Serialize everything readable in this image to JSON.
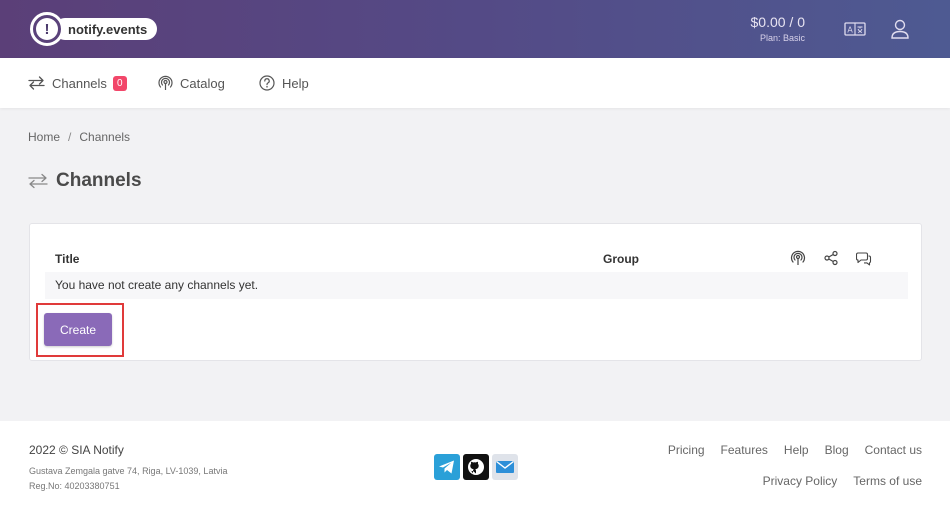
{
  "header": {
    "logo_text": "notify.events",
    "logo_mark": "!",
    "balance": "$0.00 / 0",
    "plan": "Plan: Basic",
    "icons": [
      "language-icon",
      "user-icon"
    ]
  },
  "nav": {
    "channels": {
      "label": "Channels",
      "badge": "0",
      "icon": "arrows-exchange-icon"
    },
    "catalog": {
      "label": "Catalog",
      "icon": "broadcast-icon"
    },
    "help": {
      "label": "Help",
      "icon": "question-circle-icon"
    }
  },
  "breadcrumb": [
    "Home",
    "Channels"
  ],
  "page": {
    "title": "Channels",
    "icon": "arrows-exchange-icon"
  },
  "table": {
    "columns": {
      "title": "Title",
      "group": "Group"
    },
    "column_icons": [
      "broadcast-icon",
      "share-icon",
      "chat-icon"
    ],
    "empty_text": "You have not create any channels yet."
  },
  "create_button": "Create",
  "accent_color": "#8a6ab8",
  "footer": {
    "copyright": "2022 © SIA Notify",
    "address": "Gustava Zemgala gatve 74, Riga, LV-1039, Latvia",
    "reg": "Reg.No: 40203380751",
    "socials": [
      "telegram-icon",
      "github-icon",
      "mail-icon"
    ],
    "links_row1": [
      "Pricing",
      "Features",
      "Help",
      "Blog",
      "Contact us"
    ],
    "links_row2": [
      "Privacy Policy",
      "Terms of use"
    ]
  }
}
